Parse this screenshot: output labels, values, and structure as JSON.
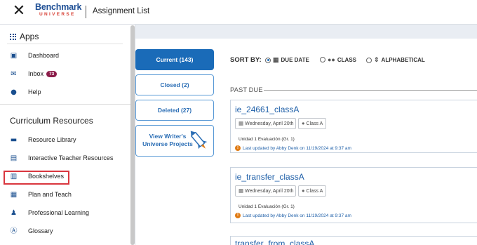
{
  "header": {
    "close_label": "✕",
    "logo_main": "Benchmark",
    "logo_sub": "UNIVERSE",
    "title": "Assignment List"
  },
  "drawer": {
    "apps_title": "Apps",
    "apps": [
      {
        "label": "Dashboard",
        "icon": "dashboard-icon"
      },
      {
        "label": "Inbox",
        "icon": "mail-icon",
        "badge": "73"
      },
      {
        "label": "Help",
        "icon": "help-icon"
      }
    ],
    "section_title": "Curriculum Resources",
    "resources": [
      {
        "label": "Resource Library",
        "icon": "book-open-icon"
      },
      {
        "label": "Interactive Teacher Resources",
        "icon": "interactive-icon"
      },
      {
        "label": "Bookshelves",
        "icon": "bookshelves-icon"
      },
      {
        "label": "Plan and Teach",
        "icon": "plan-teach-icon"
      },
      {
        "label": "Professional Learning",
        "icon": "teacher-icon"
      },
      {
        "label": "Glossary",
        "icon": "glossary-icon"
      }
    ]
  },
  "filters": {
    "current": "Current (143)",
    "closed": "Closed (2)",
    "deleted": "Deleted (27)",
    "writers_universe": "View Writer's Universe Projects"
  },
  "sort": {
    "label": "SORT BY:",
    "options": [
      "DUE DATE",
      "CLASS",
      "ALPHABETICAL"
    ],
    "selected": "DUE DATE"
  },
  "section": "PAST DUE",
  "assignments": [
    {
      "title": "ie_24661_classA",
      "date": "Wednesday, April 20th",
      "class": "Class A",
      "unit": "Unidad 1 Evaluación (Gr. 1)",
      "updated": "Last updated by Abby Denk on 11/19/2024 at 9:37 am"
    },
    {
      "title": "ie_transfer_classA",
      "date": "Wednesday, April 20th",
      "class": "Class A",
      "unit": "Unidad 1 Evaluación (Gr. 1)",
      "updated": "Last updated by Abby Denk on 11/19/2024 at 9:37 am"
    },
    {
      "title": "transfer_from_classA"
    }
  ]
}
